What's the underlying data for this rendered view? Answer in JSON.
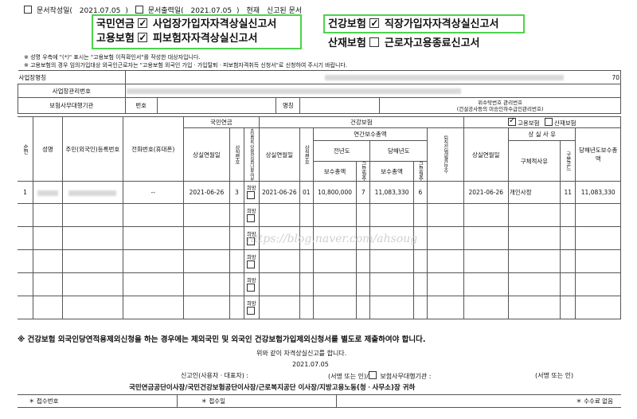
{
  "top": {
    "doc_written_label": "문서작성일(",
    "doc_written_date": "2021.07.05",
    "doc_printed_label": "문서출력일(",
    "doc_printed_date": "2021.07.05",
    "current_label": "현재",
    "status": "신고된 문서"
  },
  "forms": {
    "np_label": "국민연금",
    "np_form": "사업장가입자자격상실신고서",
    "ei_label": "고용보험",
    "ei_form": "피보험자자격상실신고서",
    "hi_label": "건강보험",
    "hi_form": "직장가입자자격상실신고서",
    "ia_label": "산재보험",
    "ia_form": "근로자고용종료신고서"
  },
  "notes": [
    "※ 성명 우측에 \"(*)\" 표시는 \"고용보험 이직확인서\"를 작성한 대상자입니다.",
    "※ 고용보험의 경우 임의가입대상 외국인근로자는 \"고용보험 외국인 가입ㆍ가입탈퇴ㆍ피보험자격취득 신청서\"로 신청하여 주시기 바랍니다."
  ],
  "header_table": {
    "workplace_name": "사업장명칭",
    "workplace_mgmt_no": "사업장관리번호",
    "agency": "보험사무대행기관",
    "number": "번호",
    "name": "명칭",
    "agency_mgmt_note_1": "위수탁번호 관리번호",
    "agency_mgmt_note_2": "(건설공사등의 미승인하수급인관리번호)",
    "trailing_code": "70"
  },
  "main_table": {
    "seq": "순번",
    "name": "성명",
    "rrn": "주민(외국인)등록번호",
    "phone": "전화번호(휴대폰)",
    "np_group": "국민연금",
    "np_loss_date": "상실연월일",
    "np_code": "상실부호",
    "np_pay_hope": "초일취득·당월상실자납부여부",
    "hi_group": "건강보험",
    "hi_loss_date": "상실연월일",
    "hi_code": "상실부호",
    "annual_pay": "연간보수총액",
    "prev_year": "전년도",
    "curr_year": "당해년도",
    "pay_total": "보수총액",
    "months": "근무월수",
    "retire_note": "퇴직전3개월간보수",
    "ei_checkbox": "고용보험",
    "ia_checkbox": "산재보험",
    "ei_loss_date": "상실연월일",
    "loss_reason": "상 실 사 유",
    "detail_reason": "구체적사유",
    "reason_code": "구분코드",
    "curr_pay": "당해년도보수총액",
    "hope": "희망"
  },
  "rows": [
    {
      "seq": "1",
      "phone": "--",
      "np_date": "2021-06-26",
      "np_code": "3",
      "hi_date": "2021-06-26",
      "hi_code": "01",
      "prev_pay": "10,800,000",
      "prev_months": "7",
      "curr_pay": "11,083,330",
      "curr_months": "6",
      "ei_date": "2021-06-26",
      "reason": "개인사정",
      "reason_code": "11",
      "ei_pay": "11,083,330"
    }
  ],
  "footer": {
    "warning": "※ 건강보험 외국인당연적용제외신청을 하는 경우에는 제외국민 및 외국인 건강보험가입제외신청서를 별도로 제출하여야 합니다.",
    "declare": "위와 같이 자격상실신고를 합니다.",
    "date": "2021.07.05",
    "reporter": "신고인(사용자ㆍ대표자) :",
    "sign1": "(서명 또는 인)/",
    "agency_label": "보험사무대행기관 :",
    "sign2": "(서명 또는 인)",
    "addressees": "국민연금공단이사장/국민건강보험공단이사장/근로복지공단 이사장/지방고용노동(청ㆍ사무소)장 귀하",
    "receipt_no": "＊ 접수번호",
    "receipt_date": "＊ 접수일",
    "fee": "＊ 수수료 없음"
  },
  "watermark": "https://blog.naver.com/ahsoug"
}
